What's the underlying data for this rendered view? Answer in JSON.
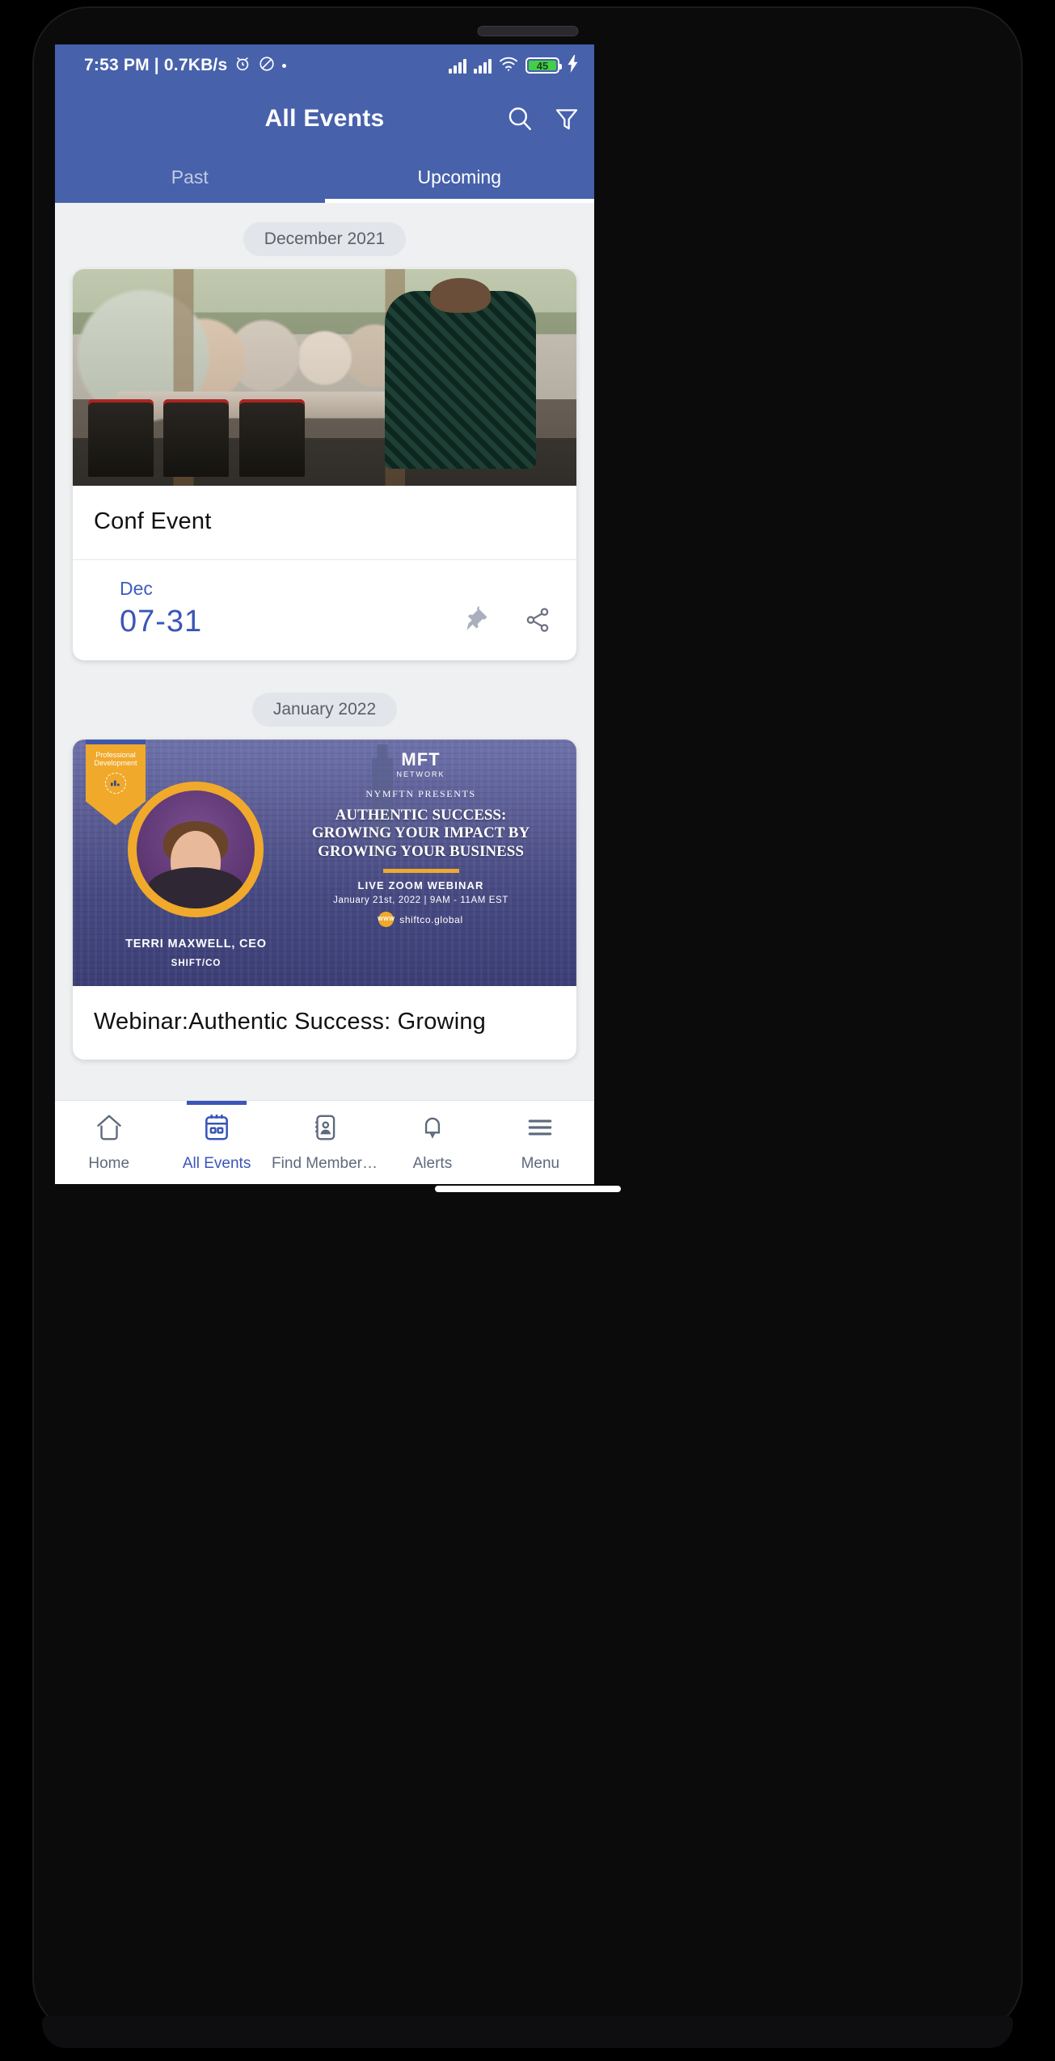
{
  "status_bar": {
    "time_and_rate": "7:53 PM | 0.7KB/s",
    "alarm_icon": "alarm-icon",
    "dnd_icon": "do-not-disturb-icon",
    "dot": "·",
    "signal_1_icon": "signal-bars-icon",
    "signal_2_icon": "signal-bars-icon",
    "wifi_icon": "wifi-icon",
    "battery_level": "45",
    "charging_icon": "charging-bolt-icon"
  },
  "app_bar": {
    "title": "All Events",
    "search_icon": "search-icon",
    "filter_icon": "filter-icon"
  },
  "tabs": [
    {
      "label": "Past",
      "active": false
    },
    {
      "label": "Upcoming",
      "active": true
    }
  ],
  "sections": [
    {
      "month_chip": "December 2021",
      "event": {
        "title": "Conf Event",
        "date_month": "Dec",
        "date_range": "07-31",
        "pin_icon": "pin-icon",
        "share_icon": "share-icon"
      }
    },
    {
      "month_chip": "January 2022",
      "event": {
        "title": "Webinar:Authentic Success: Growing",
        "poster": {
          "ribbon_line1": "Professional",
          "ribbon_line2": "Development",
          "ribbon_icon": "growth-chart-in-hands-icon",
          "logo_mark": "MFT",
          "logo_sub": "NETWORK",
          "presents": "NYMFTN PRESENTS",
          "headline_line1": "AUTHENTIC SUCCESS:",
          "headline_line2": "GROWING YOUR IMPACT BY",
          "headline_line3": "GROWING YOUR BUSINESS",
          "format": "LIVE ZOOM WEBINAR",
          "when": "January 21st, 2022 | 9AM - 11AM EST",
          "website": "shiftco.global",
          "www_badge": "WWW",
          "speaker_name": "TERRI MAXWELL, CEO",
          "speaker_org": "SHIFT/CO"
        }
      }
    }
  ],
  "bottom_nav": [
    {
      "label": "Home",
      "icon": "home-icon",
      "active": false
    },
    {
      "label": "All Events",
      "icon": "calendar-icon",
      "active": true
    },
    {
      "label": "Find Member…",
      "icon": "contact-card-icon",
      "active": false
    },
    {
      "label": "Alerts",
      "icon": "bell-icon",
      "active": false
    },
    {
      "label": "Menu",
      "icon": "hamburger-icon",
      "active": false
    }
  ],
  "colors": {
    "brand_blue": "#4761ab",
    "accent_blue": "#3b55b8",
    "gold": "#f0a92b",
    "battery_green": "#43d049",
    "page_bg": "#eef0f1"
  }
}
